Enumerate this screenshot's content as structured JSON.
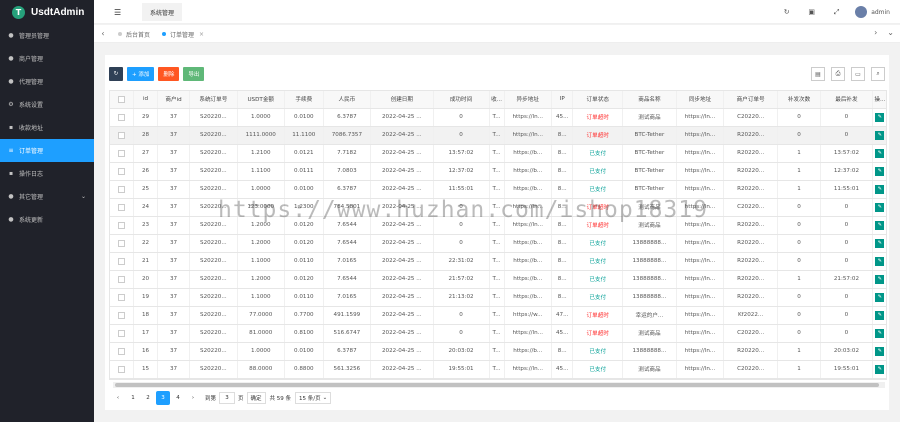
{
  "brand": {
    "name": "UsdtAdmin",
    "logo_letter": "T",
    "logo_color": "#26a17b"
  },
  "sidebar": {
    "items": [
      {
        "label": "管理员管理",
        "icon": "user-icon",
        "active": false
      },
      {
        "label": "商户管理",
        "icon": "user-icon",
        "active": false
      },
      {
        "label": "代理管理",
        "icon": "user-icon",
        "active": false
      },
      {
        "label": "系统设置",
        "icon": "gear-icon",
        "active": false
      },
      {
        "label": "收款地址",
        "icon": "wallet-icon",
        "active": false
      },
      {
        "label": "订单管理",
        "icon": "list-icon",
        "active": true
      },
      {
        "label": "操作日志",
        "icon": "log-icon",
        "active": false
      },
      {
        "label": "其它管理",
        "icon": "folder-icon",
        "active": false,
        "caret": "⌄"
      },
      {
        "label": "系统更新",
        "icon": "update-icon",
        "active": false
      }
    ]
  },
  "header": {
    "tab_label": "系统管理",
    "user": "admin",
    "icons": [
      "refresh-icon",
      "lock-icon",
      "fullscreen-icon"
    ]
  },
  "tabs": [
    {
      "label": "后台首页",
      "active": false
    },
    {
      "label": "订单管理",
      "active": true,
      "close": "×"
    }
  ],
  "toolbar": {
    "add_label": "+ 添加",
    "delete_label": "删除",
    "export_label": "导出"
  },
  "table": {
    "columns": [
      "",
      "id",
      "商户id",
      "系统订单号",
      "USDT金额",
      "手续费",
      "人民币",
      "创建日期",
      "成功时间",
      "收...",
      "异步地址",
      "IP",
      "订单状态",
      "商品名称",
      "同步地址",
      "商户订单号",
      "补发次数",
      "最后补发",
      "操..."
    ],
    "rows": [
      [
        "29",
        "37",
        "S20220...",
        "1.0000",
        "0.0100",
        "6.3787",
        "2022-04-25 ...",
        "0",
        "T...",
        "https://ln...",
        "45...",
        "订单超时",
        "测试商品",
        "https://ln...",
        "C20220...",
        "0",
        "0"
      ],
      [
        "28",
        "37",
        "S20220...",
        "1111.0000",
        "11.1100",
        "7086.7357",
        "2022-04-25 ...",
        "0",
        "T...",
        "https://ln...",
        "8...",
        "订单超时",
        "BTC-Tether",
        "https://ln...",
        "R20220...",
        "0",
        "0"
      ],
      [
        "27",
        "37",
        "S20220...",
        "1.2100",
        "0.0121",
        "7.7182",
        "2022-04-25 ...",
        "13:57:02",
        "T...",
        "https://b...",
        "8...",
        "已支付",
        "BTC-Tether",
        "https://ln...",
        "R20220...",
        "1",
        "13:57:02"
      ],
      [
        "26",
        "37",
        "S20220...",
        "1.1100",
        "0.0111",
        "7.0803",
        "2022-04-25 ...",
        "12:37:02",
        "T...",
        "https://b...",
        "8...",
        "已支付",
        "BTC-Tether",
        "https://ln...",
        "R20220...",
        "1",
        "12:37:02"
      ],
      [
        "25",
        "37",
        "S20220...",
        "1.0000",
        "0.0100",
        "6.3787",
        "2022-04-25 ...",
        "11:55:01",
        "T...",
        "https://b...",
        "8...",
        "已支付",
        "BTC-Tether",
        "https://ln...",
        "R20220...",
        "1",
        "11:55:01"
      ],
      [
        "24",
        "37",
        "S20220...",
        "123.0000",
        "1.2300",
        "784.5801",
        "2022-04-25 ...",
        "0",
        "T...",
        "https://ln...",
        "8...",
        "订单超时",
        "测试商品",
        "https://ln...",
        "C20220...",
        "0",
        "0"
      ],
      [
        "23",
        "37",
        "S20220...",
        "1.2000",
        "0.0120",
        "7.6544",
        "2022-04-25 ...",
        "0",
        "T...",
        "https://ln...",
        "8...",
        "订单超时",
        "测试商品",
        "https://ln...",
        "R20220...",
        "0",
        "0"
      ],
      [
        "22",
        "37",
        "S20220...",
        "1.2000",
        "0.0120",
        "7.6544",
        "2022-04-25 ...",
        "0",
        "T...",
        "https://b...",
        "8...",
        "已支付",
        "13888888...",
        "https://ln...",
        "R20220...",
        "0",
        "0"
      ],
      [
        "21",
        "37",
        "S20220...",
        "1.1000",
        "0.0110",
        "7.0165",
        "2022-04-25 ...",
        "22:31:02",
        "T...",
        "https://b...",
        "8...",
        "已支付",
        "13888888...",
        "https://ln...",
        "R20220...",
        "0",
        "0"
      ],
      [
        "20",
        "37",
        "S20220...",
        "1.2000",
        "0.0120",
        "7.6544",
        "2022-04-25 ...",
        "21:57:02",
        "T...",
        "https://b...",
        "8...",
        "已支付",
        "13888888...",
        "https://ln...",
        "R20220...",
        "1",
        "21:57:02"
      ],
      [
        "19",
        "37",
        "S20220...",
        "1.1000",
        "0.0110",
        "7.0165",
        "2022-04-25 ...",
        "21:13:02",
        "T...",
        "https://b...",
        "8...",
        "已支付",
        "13888888...",
        "https://ln...",
        "R20220...",
        "0",
        "0"
      ],
      [
        "18",
        "37",
        "S20220...",
        "77.0000",
        "0.7700",
        "491.1599",
        "2022-04-25 ...",
        "0",
        "T...",
        "https://w...",
        "47...",
        "订单超时",
        "幸运的户...",
        "https://ln...",
        "Kf2022...",
        "0",
        "0"
      ],
      [
        "17",
        "37",
        "S20220...",
        "81.0000",
        "0.8100",
        "516.6747",
        "2022-04-25 ...",
        "0",
        "T...",
        "https://ln...",
        "45...",
        "订单超时",
        "测试商品",
        "https://ln...",
        "C20220...",
        "0",
        "0"
      ],
      [
        "16",
        "37",
        "S20220...",
        "1.0000",
        "0.0100",
        "6.3787",
        "2022-04-25 ...",
        "20:03:02",
        "T...",
        "https://b...",
        "8...",
        "已支付",
        "13888888...",
        "https://ln...",
        "R20220...",
        "1",
        "20:03:02"
      ],
      [
        "15",
        "37",
        "S20220...",
        "88.0000",
        "0.8800",
        "561.3256",
        "2022-04-25 ...",
        "19:55:01",
        "T...",
        "https://ln...",
        "45...",
        "已支付",
        "测试商品",
        "https://ln...",
        "C20220...",
        "1",
        "19:55:01"
      ]
    ],
    "op_glyph": "✎"
  },
  "pager": {
    "prev": "‹",
    "pages": [
      "1",
      "2",
      "3",
      "4"
    ],
    "current": "3",
    "next": "›",
    "goto_label": "到第",
    "goto_value": "3",
    "page_suffix": "页",
    "confirm": "确定",
    "total": "共 59 条",
    "per_page": "15 条/页"
  },
  "watermark": "https://www.huzhan.com/ishop18319",
  "colors": {
    "sidebar_bg": "#20222a",
    "active_blue": "#1e9fff",
    "paid_color": "#009f95",
    "timeout_color": "#ff2d2d"
  }
}
